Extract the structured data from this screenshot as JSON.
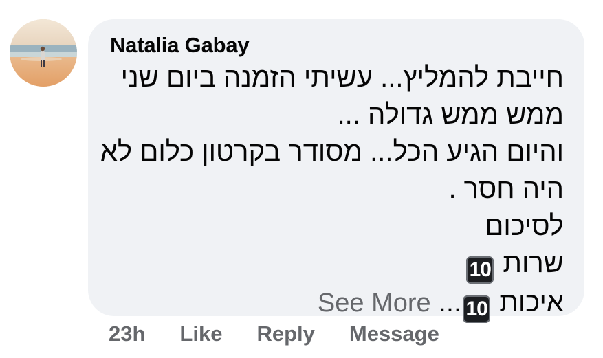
{
  "comment": {
    "author": "Natalia Gabay",
    "lines": [
      "חייבת להמליץ... עשיתי הזמנה ביום שני",
      "ממש ממש גדולה ...",
      "והיום הגיע הכל... מסודר בקרטון כלום לא",
      "היה חסר .",
      "לסיכום"
    ],
    "service_label": "שרות",
    "service_score": "10",
    "quality_label": "איכות",
    "quality_score": "10",
    "ellipsis": "...",
    "see_more": "See More"
  },
  "actions": {
    "time": "23h",
    "like": "Like",
    "reply": "Reply",
    "message": "Message"
  },
  "colors": {
    "bubble": "#f0f2f5",
    "text": "#050505",
    "muted": "#65676b",
    "badge": "#1c1e21"
  }
}
